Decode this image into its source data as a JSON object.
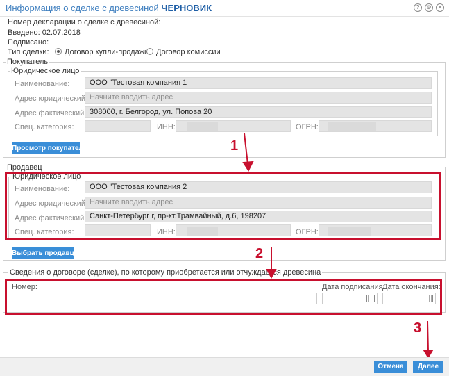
{
  "header": {
    "title": "Информация о сделке с древесиной",
    "status": "ЧЕРНОВИК",
    "icons": [
      "help-icon",
      "settings-icon",
      "close-icon"
    ]
  },
  "info": {
    "declaration_label": "Номер декларации о сделке с древесиной:",
    "entered_label": "Введено: 02.07.2018",
    "signed_label": "Подписано:",
    "deal_type_label": "Тип сделки:",
    "deal_types": [
      "Договор купли-продажи",
      "Договор комиссии"
    ],
    "selected_deal_type": "Договор купли-продажи"
  },
  "buyer": {
    "section": "Покупатель",
    "legal": "Юридическое лицо",
    "name_label": "Наименование:",
    "name_value": "ООО \"Тестовая компания  1",
    "legal_address_label": "Адрес юридический:",
    "legal_address_placeholder": "Начните вводить адрес",
    "actual_address_label": "Адрес фактический:",
    "actual_address_value": "308000, г. Белгород, ул. Попова 20",
    "category_label": "Спец. категория:",
    "inn_label": "ИНН:",
    "ogrn_label": "ОГРН:",
    "button": "Просмотр покупателя"
  },
  "seller": {
    "section": "Продавец",
    "legal": "Юридическое лицо",
    "name_label": "Наименование:",
    "name_value": "ООО \"Тестовая компания 2",
    "legal_address_label": "Адрес юридический:",
    "legal_address_placeholder": "Начните вводить адрес",
    "actual_address_label": "Адрес фактический:",
    "actual_address_value": "Санкт-Петербург г, пр-кт.Трамвайный, д.6, 198207",
    "category_label": "Спец. категория:",
    "inn_label": "ИНН:",
    "ogrn_label": "ОГРН:",
    "button": "Выбрать продавца"
  },
  "contract": {
    "section": "Сведения о договоре (сделке), по которому приобретается или отчуждается древесина",
    "number_label": "Номер:",
    "sign_date_label": "Дата подписания:",
    "end_date_label": "Дата окончания:"
  },
  "annotations": {
    "n1": "1",
    "n2": "2",
    "n3": "3",
    "color": "#c8102e"
  },
  "footer": {
    "cancel": "Отмена",
    "next": "Далее"
  }
}
